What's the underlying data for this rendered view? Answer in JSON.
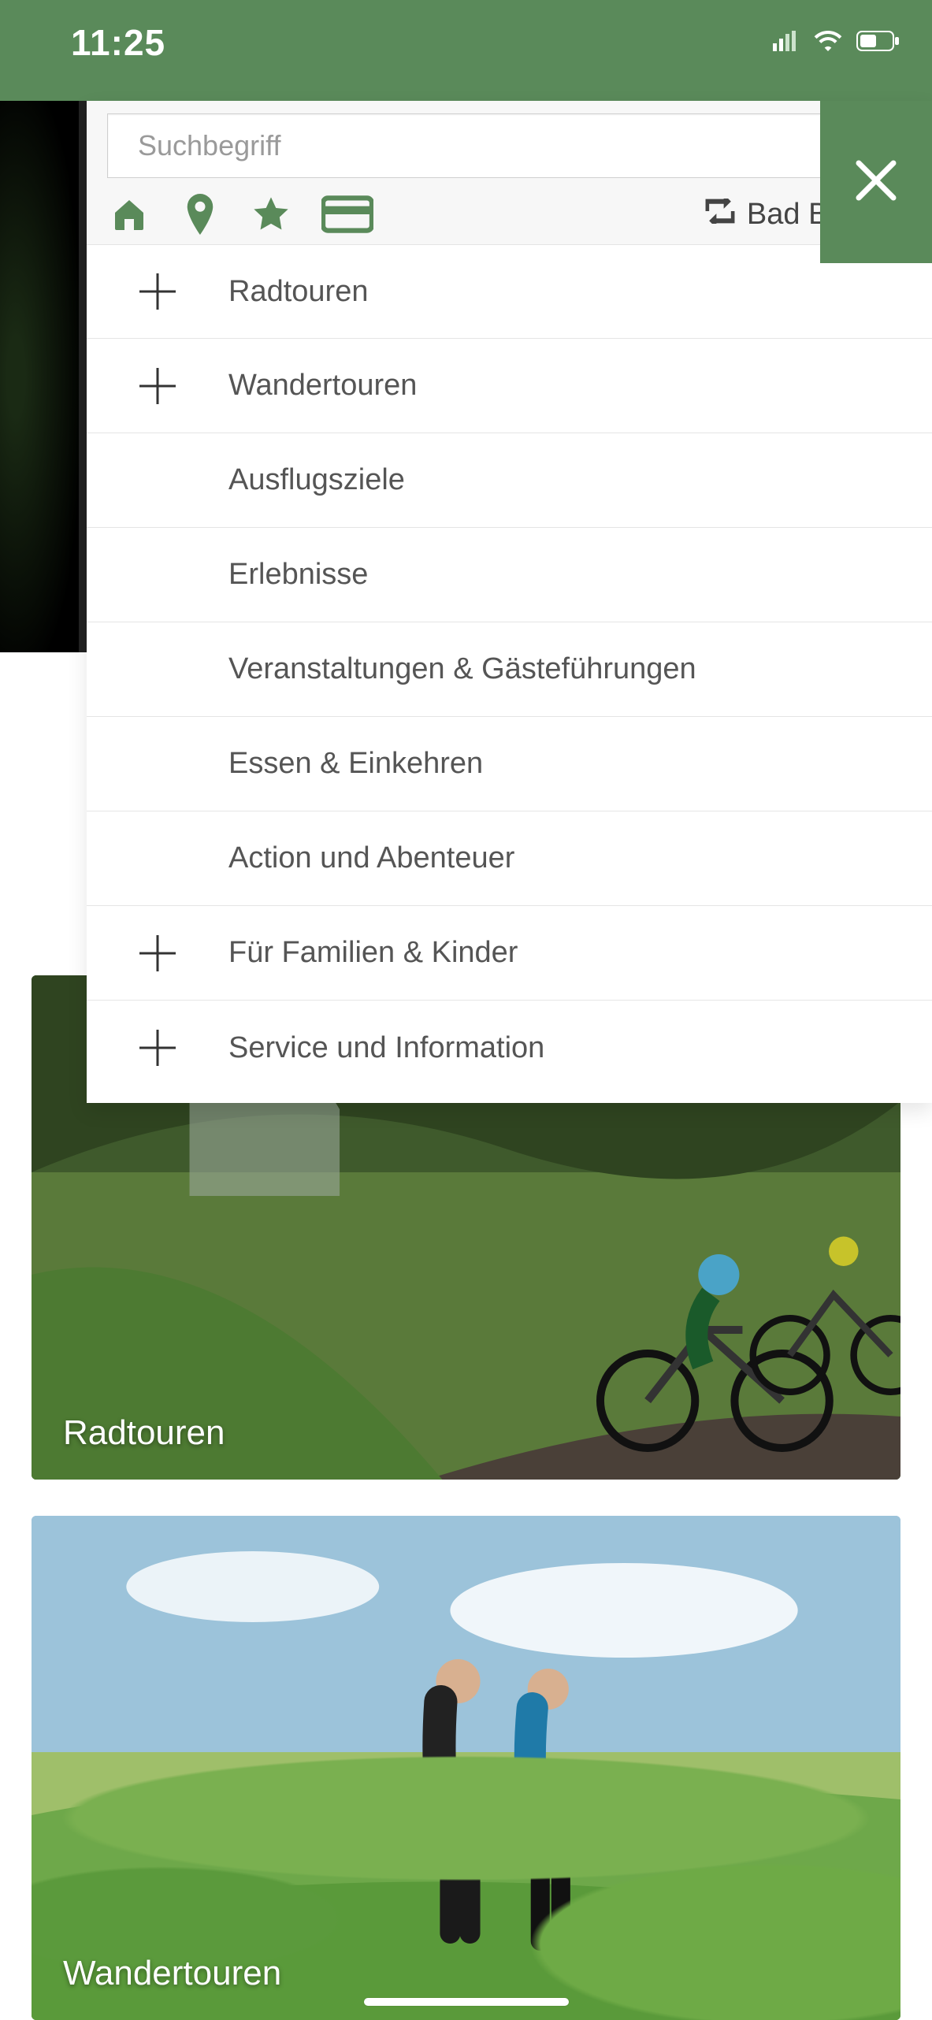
{
  "statusbar": {
    "time": "11:25"
  },
  "colors": {
    "brand": "#5a8a5a"
  },
  "search": {
    "placeholder": "Suchbegriff"
  },
  "brand": {
    "label": "Bad Bertrich"
  },
  "icons": {
    "home": "home-icon",
    "pin": "pin-icon",
    "star": "star-icon",
    "card": "card-icon",
    "retweet": "retweet-icon",
    "close": "close-icon",
    "search": "search-icon"
  },
  "menu": [
    {
      "label": "Radtouren",
      "expandable": true
    },
    {
      "label": "Wandertouren",
      "expandable": true
    },
    {
      "label": "Ausflugsziele",
      "expandable": false
    },
    {
      "label": "Erlebnisse",
      "expandable": false
    },
    {
      "label": "Veranstaltungen & Gästeführungen",
      "expandable": false
    },
    {
      "label": "Essen & Einkehren",
      "expandable": false
    },
    {
      "label": "Action und Abenteuer",
      "expandable": false
    },
    {
      "label": "Für Familien & Kinder",
      "expandable": true
    },
    {
      "label": "Service und Information",
      "expandable": true
    }
  ],
  "cards": {
    "rad": {
      "label": "Radtouren"
    },
    "wan": {
      "label": "Wandertouren"
    }
  }
}
